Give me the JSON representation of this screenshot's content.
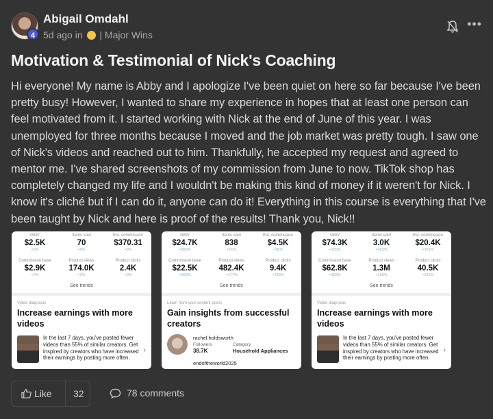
{
  "post": {
    "author": "Abigail Omdahl",
    "level": "4",
    "time": "5d ago in",
    "category": "Major Wins",
    "separator": "|",
    "title": "Motivation & Testimonial of Nick's Coaching",
    "body": "Hi everyone! My name is Abby and I apologize I've been quiet on here so far because I've been pretty busy! However, I wanted to share my experience in hopes that at least one person can feel motivated from it. I started working with Nick at the end of June of this year. I was unemployed for three months because I moved and the job market was pretty tough. I saw one of Nick's videos and reached out to him. Thankfully, he accepted my request and agreed to mentor me. I've shared screenshots of my commission from June to now. TikTok shop has completely changed my life and I wouldn't be making this kind of money if it weren't for Nick. I know it's cliché but if I can do it, anyone can do it! Everything in this course is everything that I've been taught by Nick and here is proof of the results! Thank you, Nick!!"
  },
  "icons": {
    "bell": "bell-off-icon",
    "more": "more-horizontal-icon",
    "like": "thumbs-up-icon",
    "comment": "comment-icon",
    "emoji": "smiley-emoji-icon"
  },
  "screenshots": [
    {
      "stats": [
        {
          "label": "GMV",
          "value": "$2.5K",
          "pct": "+0%"
        },
        {
          "label": "Items sold",
          "value": "70",
          "pct": "+0%"
        },
        {
          "label": "Est. commission",
          "value": "$370.31",
          "pct": "+0%"
        },
        {
          "label": "Commission base",
          "value": "$2.9K",
          "pct": "+0%"
        },
        {
          "label": "Product views",
          "value": "174.0K",
          "pct": "+0%"
        },
        {
          "label": "Product clicks",
          "value": "2.4K",
          "pct": "+0%"
        }
      ],
      "trends": "See trends",
      "tag": "Video diagnosis",
      "headline": "Increase earnings with more videos",
      "desc": "In the last 7 days, you've posted fewer videos than 55% of similar creators. Get inspired by creators who have increased their earnings by posting more often."
    },
    {
      "stats": [
        {
          "label": "GMV",
          "value": "$24.7K",
          "pct": "+880%"
        },
        {
          "label": "Items sold",
          "value": "838",
          "pct": "+1K%"
        },
        {
          "label": "Est. commission",
          "value": "$4.5K",
          "pct": "+1K%"
        },
        {
          "label": "Commission base",
          "value": "$22.5K",
          "pct": "+683%"
        },
        {
          "label": "Product views",
          "value": "482.4K",
          "pct": "+177%"
        },
        {
          "label": "Product clicks",
          "value": "9.4K",
          "pct": "+283%"
        }
      ],
      "trends": "See trends",
      "tag": "Learn from your content peers",
      "headline": "Gain insights from successful creators",
      "peer_name": "rachel.holdsworth",
      "followers_label": "Followers",
      "followers": "38.7K",
      "category_label": "Category",
      "category": "Household Appliances",
      "peer2": "endoftheworld2025"
    },
    {
      "stats": [
        {
          "label": "GMV",
          "value": "$74.3K",
          "pct": "+205%"
        },
        {
          "label": "Items sold",
          "value": "3.0K",
          "pct": "+263%"
        },
        {
          "label": "Est. commission",
          "value": "$20.4K",
          "pct": "+351%"
        },
        {
          "label": "Commission base",
          "value": "$62.8K",
          "pct": "+183%"
        },
        {
          "label": "Product views",
          "value": "1.3M",
          "pct": "+199%"
        },
        {
          "label": "Product clicks",
          "value": "40.5K",
          "pct": "+351%"
        }
      ],
      "trends": "See trends",
      "tag": "Video diagnosis",
      "headline": "Increase earnings with more videos",
      "desc": "In the last 7 days, you've posted fewer videos than 55% of similar creators. Get inspired by creators who have increased their earnings by posting more often."
    }
  ],
  "actions": {
    "like_label": "Like",
    "like_count": "32",
    "comments_label": "78 comments"
  }
}
